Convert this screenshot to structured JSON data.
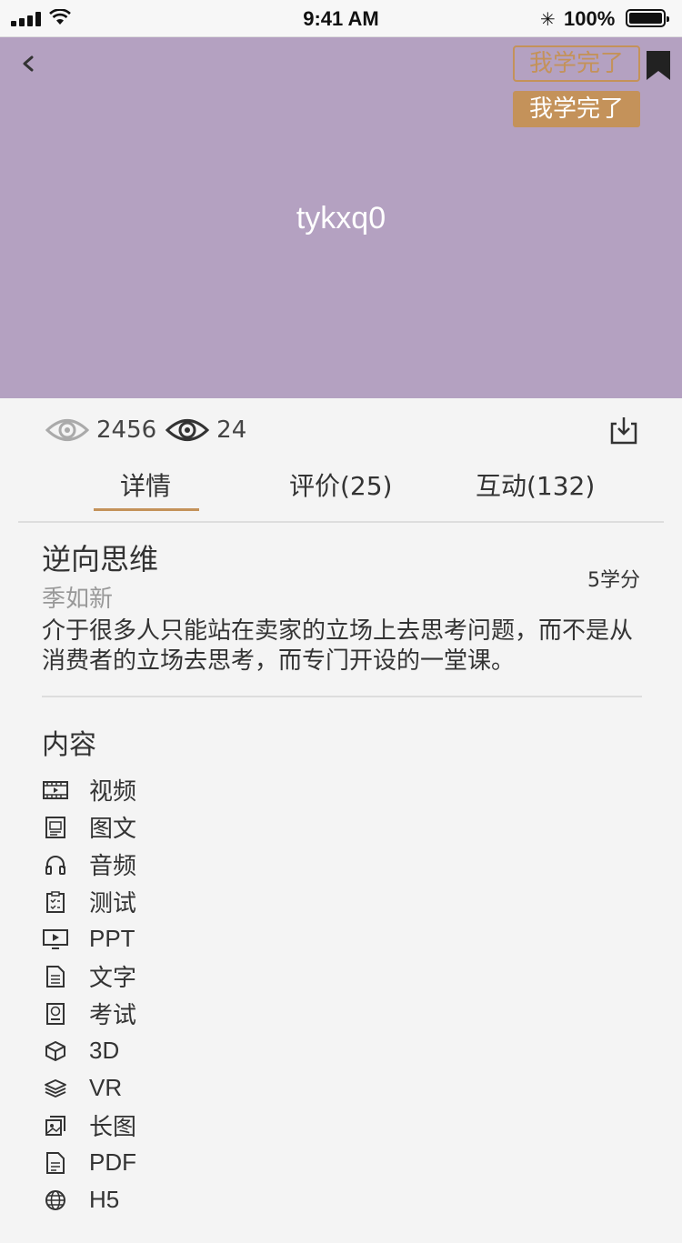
{
  "status_bar": {
    "time": "9:41 AM",
    "battery": "100%"
  },
  "hero": {
    "title": "tykxq0",
    "done_outline_label": "我学完了",
    "done_filled_label": "我学完了",
    "background": "#b4a1c1",
    "accent": "#c4925a"
  },
  "stats": {
    "views": "2456",
    "viewers": "24"
  },
  "tabs": [
    {
      "label": "详情",
      "active": true
    },
    {
      "label": "评价(25)",
      "active": false
    },
    {
      "label": "互动(132)",
      "active": false
    }
  ],
  "detail": {
    "title": "逆向思维",
    "author": "季如新",
    "credit": "5学分",
    "description": "介于很多人只能站在卖家的立场上去思考问题，而不是从消费者的立场去思考，而专门开设的一堂课。"
  },
  "content": {
    "heading": "内容",
    "items": [
      {
        "label": "视频",
        "icon": "film-icon"
      },
      {
        "label": "图文",
        "icon": "image-text-icon"
      },
      {
        "label": "音频",
        "icon": "headphones-icon"
      },
      {
        "label": "测试",
        "icon": "clipboard-icon"
      },
      {
        "label": "PPT",
        "icon": "presentation-icon"
      },
      {
        "label": "文字",
        "icon": "document-icon"
      },
      {
        "label": "考试",
        "icon": "exam-pass-icon"
      },
      {
        "label": "3D",
        "icon": "cube-icon"
      },
      {
        "label": "VR",
        "icon": "layers-icon"
      },
      {
        "label": "长图",
        "icon": "long-image-icon"
      },
      {
        "label": "PDF",
        "icon": "pdf-icon"
      },
      {
        "label": "H5",
        "icon": "globe-icon"
      }
    ]
  }
}
